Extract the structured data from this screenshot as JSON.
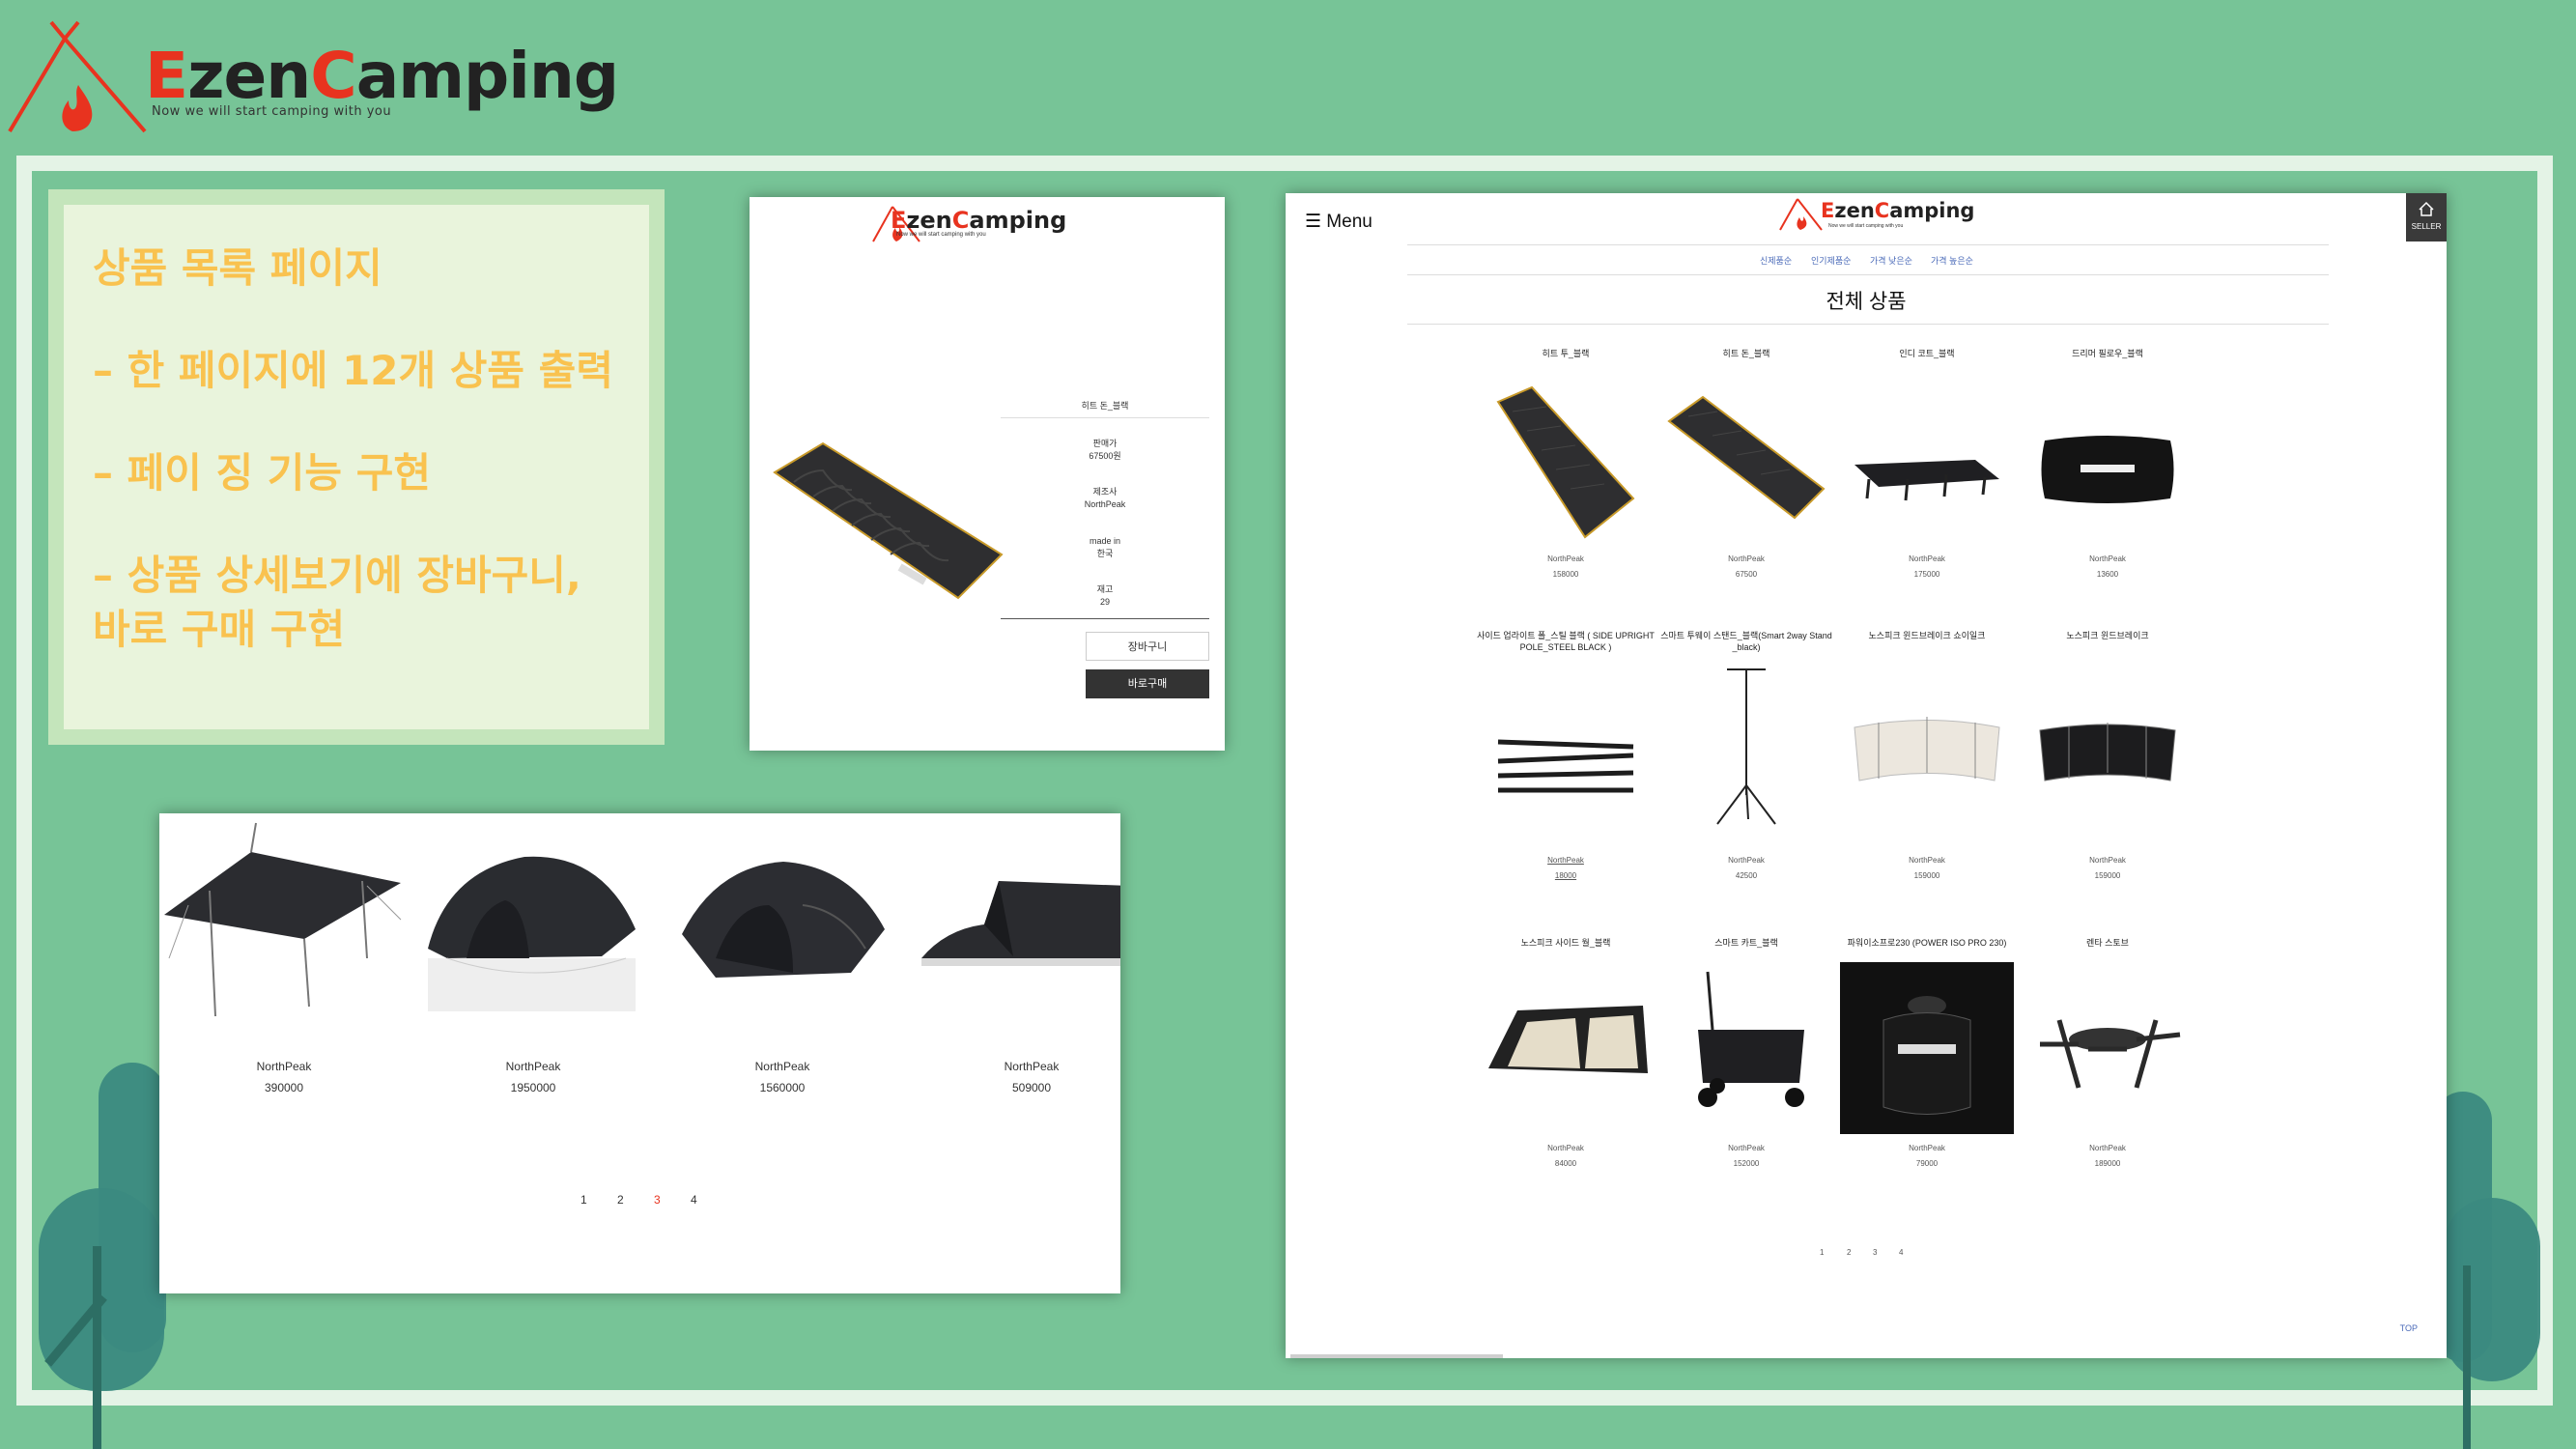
{
  "header": {
    "logo_e": "E",
    "logo_zen": "zen",
    "logo_c": "C",
    "logo_amping": "amping",
    "tagline": "Now we will start camping with you"
  },
  "colors": {
    "background": "#77c497",
    "accent_yellow": "#f9c24f",
    "logo_red": "#e8331f",
    "frame": "#e4f3e6"
  },
  "note": {
    "lines": [
      "상품 목록 페이지",
      "– 한 페이지에 12개 상품 출력",
      "– 페이 징 기능 구현",
      "– 상품 상세보기에 장바구니,\n바로 구매 구현"
    ]
  },
  "detail_page": {
    "product_name": "히트 돈_블랙",
    "price_label": "판매가",
    "price_value": "67500원",
    "maker_label": "제조사",
    "maker_value": "NorthPeak",
    "origin_label": "made in",
    "origin_value": "한국",
    "stock_label": "재고",
    "stock_value": "29",
    "cart_button": "장바구니",
    "buy_button": "바로구매"
  },
  "paging_page": {
    "items": [
      {
        "brand": "NorthPeak",
        "price": "390000"
      },
      {
        "brand": "NorthPeak",
        "price": "1950000"
      },
      {
        "brand": "NorthPeak",
        "price": "1560000"
      },
      {
        "brand": "NorthPeak",
        "price": "509000"
      }
    ],
    "pages": [
      "1",
      "2",
      "3",
      "4"
    ],
    "current_page": "3"
  },
  "list_page": {
    "menu": "☰ Menu",
    "seller": "SELLER",
    "sort_options": [
      "신제품순",
      "인기제품순",
      "가격 낮은순",
      "가격 높은순"
    ],
    "section_title": "전체 상품",
    "products": [
      {
        "name": "히트 투_블랙",
        "brand": "NorthPeak",
        "price": "158000"
      },
      {
        "name": "히트 돈_블랙",
        "brand": "NorthPeak",
        "price": "67500"
      },
      {
        "name": "인디 코트_블랙",
        "brand": "NorthPeak",
        "price": "175000"
      },
      {
        "name": "드리머 필로우_블랙",
        "brand": "NorthPeak",
        "price": "13600"
      },
      {
        "name": "사이드 업라이트 폴_스틸 블랙 ( SIDE UPRIGHT POLE_STEEL BLACK )",
        "brand": "NorthPeak",
        "price": "18000"
      },
      {
        "name": "스마트 투웨이 스탠드_블랙(Smart 2way Stand _black)",
        "brand": "NorthPeak",
        "price": "42500"
      },
      {
        "name": "노스피크 윈드브레이크 쇼이일크",
        "brand": "NorthPeak",
        "price": "159000"
      },
      {
        "name": "노스피크 윈드브레이크",
        "brand": "NorthPeak",
        "price": "159000"
      },
      {
        "name": "노스피크 사이드 월_블랙",
        "brand": "NorthPeak",
        "price": "84000"
      },
      {
        "name": "스마트 카트_블랙",
        "brand": "NorthPeak",
        "price": "152000"
      },
      {
        "name": "파워이소프로230 (POWER ISO PRO 230)",
        "brand": "NorthPeak",
        "price": "79000"
      },
      {
        "name": "렌타 스토브",
        "brand": "NorthPeak",
        "price": "189000"
      }
    ],
    "pages": [
      "1",
      "2",
      "3",
      "4"
    ],
    "top_link": "TOP"
  }
}
